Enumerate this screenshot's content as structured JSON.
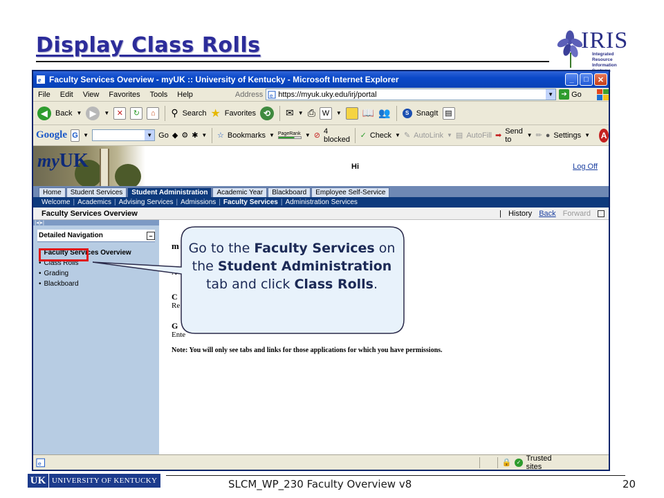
{
  "slide": {
    "title": "Display Class Rolls",
    "footer": "SLCM_WP_230 Faculty Overview v8",
    "page_number": "20",
    "uk_logo_mark": "UK",
    "uk_logo_text": "UNIVERSITY OF KENTUCKY",
    "iris_word": "IRIS",
    "iris_subtitle": "Integrated Resource Information Systems"
  },
  "browser": {
    "window_title": "Faculty Services Overview - myUK :: University of Kentucky - Microsoft Internet Explorer",
    "menu": [
      "File",
      "Edit",
      "View",
      "Favorites",
      "Tools",
      "Help"
    ],
    "address_label": "Address",
    "address_value": "https://myuk.uky.edu/irj/portal",
    "go_label": "Go",
    "toolbar": {
      "back": "Back",
      "search": "Search",
      "favorites": "Favorites",
      "snagit": "SnagIt"
    },
    "google_bar": {
      "logo": "Google",
      "go": "Go",
      "bookmarks": "Bookmarks",
      "pagerank": "PageRank",
      "blocked": "4 blocked",
      "check": "Check",
      "autolink": "AutoLink",
      "autofill": "AutoFill",
      "send_to": "Send to",
      "settings": "Settings"
    },
    "status": {
      "zone": "Trusted sites"
    }
  },
  "portal": {
    "logo_prefix": "my",
    "logo_suffix": "UK",
    "greeting": "Hi",
    "logoff": "Log Off",
    "tabs": [
      {
        "label": "Home",
        "active": false
      },
      {
        "label": "Student Services",
        "active": false
      },
      {
        "label": "Student Administration",
        "active": true
      },
      {
        "label": "Academic Year",
        "active": false
      },
      {
        "label": "Blackboard",
        "active": false
      },
      {
        "label": "Employee Self-Service",
        "active": false
      }
    ],
    "subnav": [
      {
        "label": "Welcome",
        "active": false
      },
      {
        "label": "Academics",
        "active": false
      },
      {
        "label": "Advising Services",
        "active": false
      },
      {
        "label": "Admissions",
        "active": false
      },
      {
        "label": "Faculty Services",
        "active": true
      },
      {
        "label": "Administration Services",
        "active": false
      }
    ],
    "page_title": "Faculty Services Overview",
    "history": "History",
    "back": "Back",
    "forward": "Forward",
    "nav_header": "Detailed Navigation",
    "nav_items": [
      {
        "label": "Faculty Services Overview",
        "current": true
      },
      {
        "label": "Class Rolls",
        "current": false
      },
      {
        "label": "Grading",
        "current": false
      },
      {
        "label": "Blackboard",
        "current": false
      }
    ],
    "fragments": [
      "m",
      "A",
      "C",
      "Re",
      "G",
      "Ente"
    ],
    "note": "Note:  You will only see tabs and links for those applications for which you have permissions."
  },
  "callout": {
    "p1": "Go to the ",
    "b1": "Faculty Services",
    "p2": " on the ",
    "b2": "Student Administration",
    "p3": " tab and click ",
    "b3": "Class Rolls",
    "p4": "."
  }
}
